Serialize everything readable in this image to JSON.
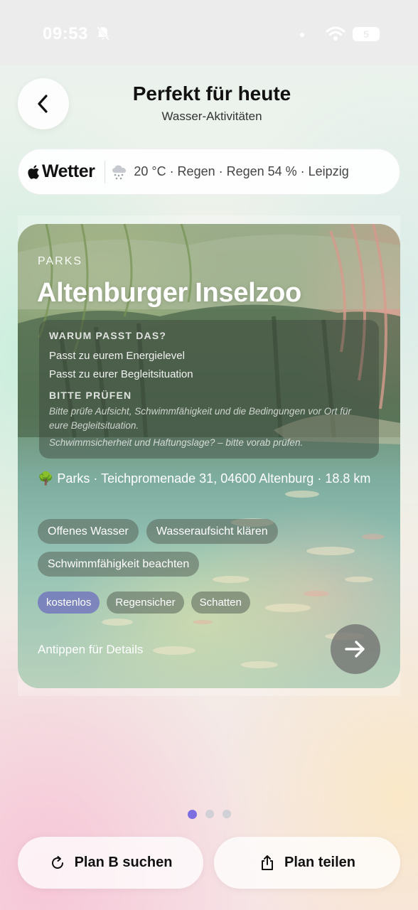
{
  "status_bar": {
    "time": "09:53",
    "battery": "5"
  },
  "header": {
    "title": "Perfekt für heute",
    "subtitle": "Wasser-Aktivitäten",
    "back_icon": "chevron-left-icon"
  },
  "weather": {
    "brand": "Wetter",
    "icon": "cloud-rain-snow-icon",
    "info": "20 °C · Regen · Regen 54 % · Leipzig"
  },
  "card": {
    "category": "PARKS",
    "title": "Altenburger Inselzoo",
    "reason_heading": "WARUM PASST DAS?",
    "reasons": [
      "Passt zu eurem Energielevel",
      "Passt zu eurer Begleitsituation"
    ],
    "check_heading": "BITTE PRÜFEN",
    "check_notes": [
      "Bitte prüfe Aufsicht, Schwimmfähigkeit und die Bedingungen vor Ort für eure Begleitsituation.",
      "Schwimmsicherheit und Haftungslage? – bitte vorab prüfen."
    ],
    "location": "🌳 Parks · Teichpromenade 31, 04600 Altenburg · 18.8 km",
    "warning_chips": [
      "Offenes Wasser",
      "Wasseraufsicht klären",
      "Schwimmfähigkeit beachten"
    ],
    "tag_chips": [
      "kostenlos",
      "Regensicher",
      "Schatten"
    ],
    "hint": "Antippen für Details",
    "accent_color": "#6e6ebe"
  },
  "pager": {
    "count": 3,
    "active_index": 0,
    "active_color": "#7c6ee0"
  },
  "actions": {
    "plan_b_label": "Plan B suchen",
    "share_label": "Plan teilen"
  }
}
